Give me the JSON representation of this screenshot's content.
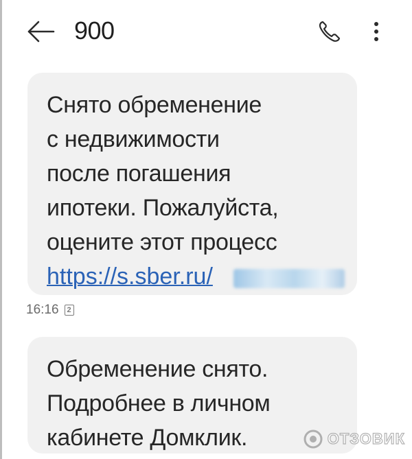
{
  "header": {
    "title": "900",
    "back_icon": "arrow-left-icon",
    "call_icon": "phone-icon",
    "more_icon": "more-vertical-icon"
  },
  "messages": [
    {
      "text": "Снято обременение\nс недвижимости\nпосле погашения\nипотеки. Пожалуйста,\nоцените этот процесс",
      "link": "https://s.sber.ru/",
      "time": "16:16",
      "sim": "2"
    },
    {
      "text": "Обременение снято.\nПодробнее в личном\nкабинете Домклик."
    }
  ],
  "watermark": "ОТЗОВИК",
  "colors": {
    "bubble": "#f1f1f1",
    "link": "#2a62b6",
    "text": "#262626"
  }
}
